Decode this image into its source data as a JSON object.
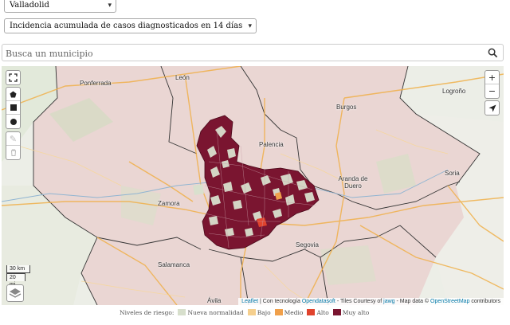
{
  "filters": {
    "region_value": "Valladolid",
    "metric_value": "Incidencia acumulada de casos diagnosticados en 14 días"
  },
  "search": {
    "placeholder": "Busca un municipio",
    "icon": "search-icon"
  },
  "map": {
    "places": [
      "Ponferrada",
      "León",
      "Burgos",
      "Logroño",
      "Palencia",
      "Aranda de Duero",
      "Soria",
      "Zamora",
      "Salamanca",
      "Segovia",
      "Ávila"
    ],
    "controls": {
      "fullscreen_icon": "fullscreen-icon",
      "zoom_in": "+",
      "zoom_out": "−",
      "locate_icon": "locate-arrow-icon",
      "draw_tools": [
        "draw-polygon-icon",
        "draw-rectangle-icon",
        "draw-circle-icon"
      ],
      "edit_tools": [
        "edit-icon",
        "delete-icon"
      ],
      "layers_icon": "layers-icon"
    },
    "scale": {
      "km": "30 km",
      "mi": "20 mi"
    },
    "attribution": {
      "leaflet": "Leaflet",
      "text1": " | Con tecnología ",
      "opendatasoft": "Opendatasoft",
      "text2": " - Tiles Courtesy of ",
      "jawg": "jawg",
      "text3": " - Map data © ",
      "osm": "OpenStreetMap",
      "text4": " contributors"
    }
  },
  "legend": {
    "title": "Niveles de riesgo:",
    "items": [
      {
        "label": "Nueva normalidad",
        "color": "#d7dfcc"
      },
      {
        "label": "Bajo",
        "color": "#f5cf8e"
      },
      {
        "label": "Medio",
        "color": "#f0a04b"
      },
      {
        "label": "Alto",
        "color": "#e0432d"
      },
      {
        "label": "Muy alto",
        "color": "#7a1530"
      }
    ]
  },
  "colors": {
    "muy_alto": "#7a1530",
    "nueva_normalidad": "#d7dfcc",
    "region": "#ead7d4",
    "outside": "#eeeeea"
  }
}
